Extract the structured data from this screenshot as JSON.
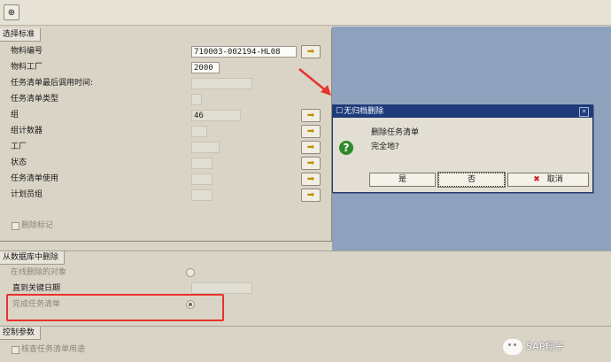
{
  "toolbar": {
    "exec_icon": "execute-icon"
  },
  "selection": {
    "title": "选择标准",
    "rows": [
      {
        "label": "物料编号",
        "value": "710003-002194-HL08"
      },
      {
        "label": "物料工厂",
        "value": "2000"
      },
      {
        "label": "任务清单最后调用时间:",
        "value": ""
      },
      {
        "label": "任务清单类型",
        "value": ""
      },
      {
        "label": "组",
        "value": "46"
      },
      {
        "label": "组计数器",
        "value": ""
      },
      {
        "label": "工厂",
        "value": ""
      },
      {
        "label": "状态",
        "value": ""
      },
      {
        "label": "任务清单使用",
        "value": ""
      },
      {
        "label": "计划员组",
        "value": ""
      }
    ],
    "delete_flag_label": "删除标记"
  },
  "db_delete": {
    "title": "从数据库中删除",
    "online_label": "在线删除的对象",
    "key_date_label": "直到关键日期",
    "complete_label": "完成任务清单"
  },
  "control": {
    "title": "控制参数",
    "check_usage_label": "核查任务清单用途"
  },
  "dialog": {
    "title": "无归档删除",
    "line1": "删除任务清单",
    "line2": "完全地?",
    "yes": "是",
    "no": "否",
    "cancel": "取消"
  },
  "watermark": "SAP翔子",
  "colors": {
    "dialog_title_bg": "#1e3a7b",
    "blue_area": "#8ea2bd",
    "highlight": "#e8322d"
  }
}
